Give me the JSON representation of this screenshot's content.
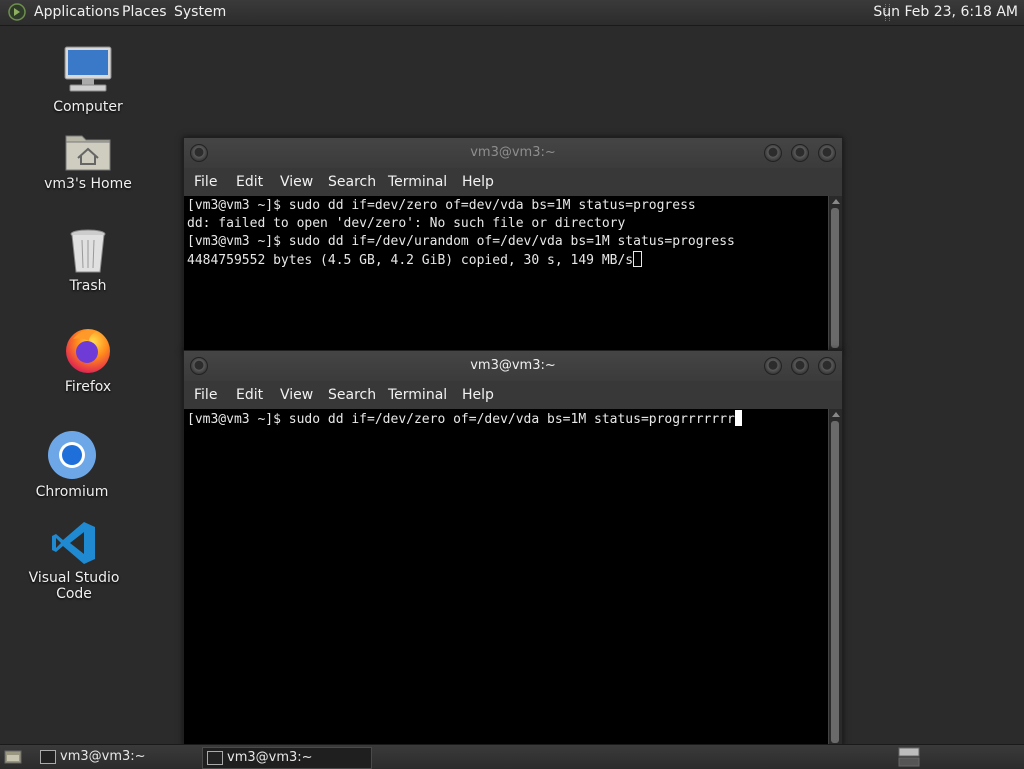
{
  "top_panel": {
    "menus": [
      "Applications",
      "Places",
      "System"
    ],
    "clock": "Sun Feb 23,  6:18 AM"
  },
  "desktop": {
    "icons": [
      {
        "label": "Computer"
      },
      {
        "label": "vm3's Home"
      },
      {
        "label": "Trash"
      },
      {
        "label": "Firefox"
      },
      {
        "label": "Chromium"
      },
      {
        "label": "Visual Studio Code"
      }
    ]
  },
  "windows": [
    {
      "title": "vm3@vm3:~",
      "menus": [
        "File",
        "Edit",
        "View",
        "Search",
        "Terminal",
        "Help"
      ],
      "lines": [
        "[vm3@vm3 ~]$ sudo dd if=dev/zero of=dev/vda bs=1M status=progress",
        "dd: failed to open 'dev/zero': No such file or directory",
        "[vm3@vm3 ~]$ sudo dd if=/dev/urandom of=/dev/vda bs=1M status=progress",
        "4484759552 bytes (4.5 GB, 4.2 GiB) copied, 30 s, 149 MB/s"
      ]
    },
    {
      "title": "vm3@vm3:~",
      "menus": [
        "File",
        "Edit",
        "View",
        "Search",
        "Terminal",
        "Help"
      ],
      "lines": [
        "[vm3@vm3 ~]$ sudo dd if=/dev/zero of=/dev/vda bs=1M status=progrrrrrrr"
      ]
    }
  ],
  "bottom_panel": {
    "tasks": [
      {
        "label": "vm3@vm3:~"
      },
      {
        "label": "vm3@vm3:~"
      }
    ]
  }
}
